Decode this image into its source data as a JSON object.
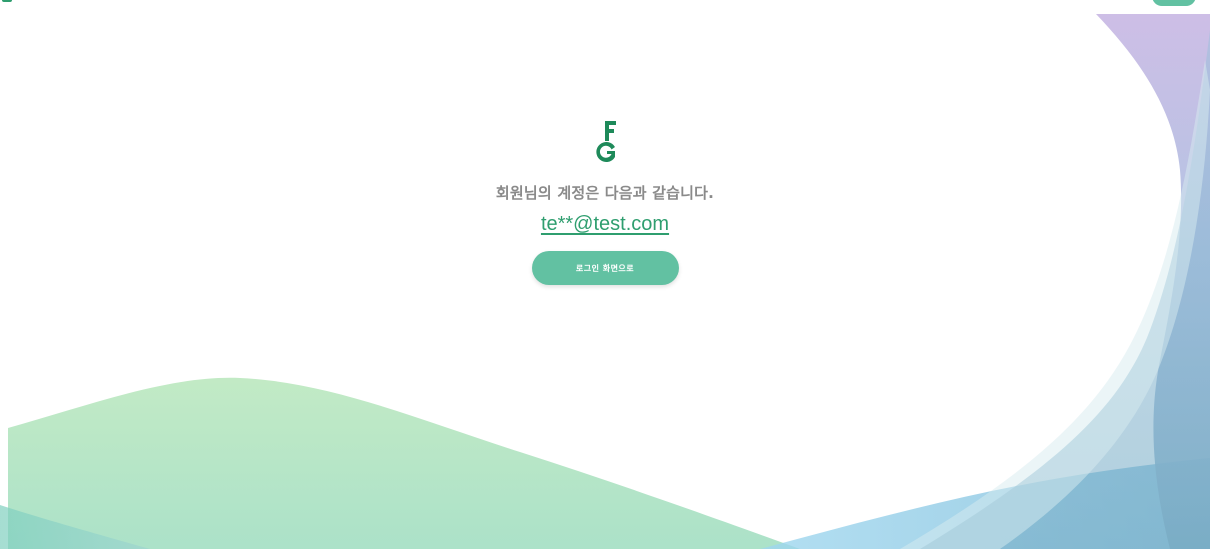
{
  "result": {
    "message": "회원님의 계정은 다음과 같습니다.",
    "account_email": "te**@test.com",
    "login_button_label": "로그인 화면으로"
  },
  "brand": {
    "logo_icon": "fg-key-logo-icon",
    "accent_color": "#2f9e6f",
    "button_color": "#62c1a2"
  }
}
